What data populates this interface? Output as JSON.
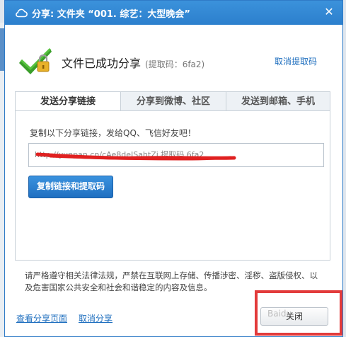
{
  "dialog": {
    "title": "分享: 文件夹 “001. 综艺：大型晚会”",
    "success_message": "文件已成功分享",
    "extract_code_text": "(提取码：6fa2)",
    "cancel_extract_code": "取消提取码"
  },
  "tabs": [
    {
      "label": "发送分享链接",
      "active": true
    },
    {
      "label": "分享到微博、社区",
      "active": false
    },
    {
      "label": "发送到邮箱、手机",
      "active": false
    }
  ],
  "panel": {
    "hint": "复制以下分享链接，发给QQ、飞信好友吧！",
    "link_value": "http://yunpan.cn/cAe8deJSahtZj  提取码 6fa2",
    "copy_button": "复制链接和提取码"
  },
  "legal_notice": "请严格遵守相关法律法规，严禁在互联网上存储、传播涉密、淫秽、盗版侵权、以及危害国家公共安全和社会和谐稳定的内容及信息。",
  "footer": {
    "view_share_page": "查看分享页面",
    "cancel_share": "取消分享",
    "close_button": "关闭"
  },
  "watermark": "Baidu",
  "colors": {
    "title_bar": "#2c7fcd",
    "accent": "#1f6fc1",
    "link": "#1f6fbf",
    "highlight": "#e23b3b",
    "redaction": "#e02020"
  },
  "icons": {
    "title": "cloud-icon",
    "success": "check-lock-icon",
    "close": "close-icon"
  }
}
